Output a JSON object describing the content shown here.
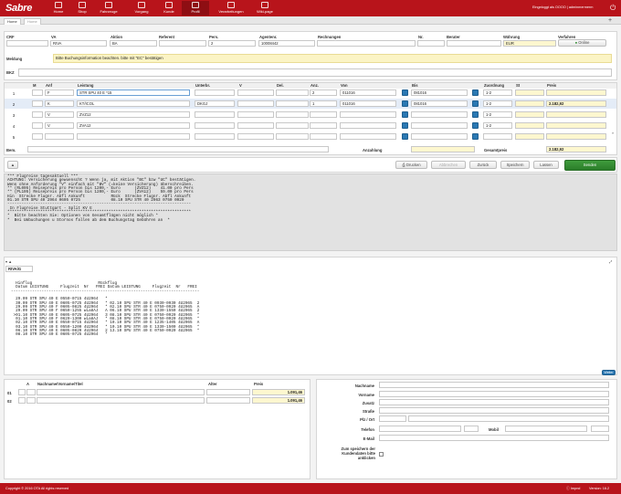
{
  "topbar": {
    "logo": "Sabre",
    "nav": [
      {
        "label": "Home"
      },
      {
        "label": "Shop"
      },
      {
        "label": "Fahrzeuge"
      },
      {
        "label": "Vorgang"
      },
      {
        "label": "Kunde"
      },
      {
        "label": "Profil"
      },
      {
        "label": "Verarbeitungen"
      },
      {
        "label": "Wiki-page"
      }
    ],
    "user": "Eingeloggt als OOOO | adminmermerm"
  },
  "tabs": [
    "Home",
    "Home"
  ],
  "booking_header": {
    "labels": [
      "CRF",
      "VA",
      "Aktion",
      "Referent",
      "Pers.",
      "Agentenr.",
      "Rechnungen",
      "Nr.",
      "Berater",
      "Währung",
      "Verfahren"
    ],
    "values": {
      "va": "RIVA",
      "aktion": "BA",
      "pers": "2",
      "agent": "10008442",
      "waehrung": "EUR",
      "verfahren": "Online"
    },
    "meldung_label": "Meldung",
    "meldung": "Bitte Buchungsinformation beachten. bitte mit \"EC\" bestätigen",
    "bkz_label": "BKZ"
  },
  "grid": {
    "headers": [
      "M",
      "Anf",
      "Leistung",
      "Unterbr.",
      "V",
      "Del.",
      "Anz.",
      "Von",
      "Bis",
      "Zuordnung",
      "St",
      "Preis"
    ],
    "rows": [
      {
        "n": "1",
        "anf": "F",
        "leistung": "STR SPU 40 E *15",
        "unterbr": "",
        "anz": "2",
        "von": "011016",
        "bis": "081016",
        "zuord": "1-2",
        "preis": ""
      },
      {
        "n": "2",
        "anf": "K",
        "leistung": "KT/ICOL",
        "unterbr": "DKGJ",
        "anz": "1",
        "von": "011016",
        "bis": "081016",
        "zuord": "1-2",
        "preis": "2.182,92"
      },
      {
        "n": "3",
        "anf": "V",
        "leistung": "ZVZ12",
        "unterbr": "",
        "anz": "",
        "von": "",
        "bis": "",
        "zuord": "1-2",
        "preis": ""
      },
      {
        "n": "4",
        "anf": "V",
        "leistung": "ZVA12",
        "unterbr": "",
        "anz": "",
        "von": "",
        "bis": "",
        "zuord": "1-2",
        "preis": ""
      },
      {
        "n": "5",
        "anf": "",
        "leistung": "",
        "unterbr": "",
        "anz": "",
        "von": "",
        "bis": "",
        "zuord": "",
        "preis": ""
      }
    ],
    "bem_label": "Bem.",
    "anzahlung_label": "Anzahlung",
    "gesamtpreis_label": "Gesamtpreis",
    "gesamtpreis": "2.182,92"
  },
  "actions": {
    "drucken": "Drucken",
    "abbrechen": "Abbrechen",
    "zurueck": "Zurück",
    "speichern": "Speichern",
    "loeschen": "Lassen",
    "senden": "Senden"
  },
  "terminal1": "*** Flugreise tagesaktuell ***\nACHTUNG: Versicherung gewuenscht ? Wenn ja, mit Aktion \"BC\" bzw \"UC\" bestätigen.\nWenn ohne Anforderung \"V\" einfach mit \"BV\" (=keine Versicherung) überschreiben.\n** (RL005) Reisepreis pro Person bis 1200,- Euro      (ZVZ12)    41.00 pro Pers\n** (PL105) Reisepreis pro Person bis 1200,- Euro      (ZVA12)    59.00 pro Pers\nHin  Strecke Flugnr. Abfl Ankunft           Rück  Strecke Flugnr. Abfl Ankunft\n01.10 STR SPU 40 2964 0605 0725             08.10 SPU STR 40 2963 0750 0920\n------------------------------------------------------------------------------\n In Flugreise Stuttgart - Split KV E\n******************************************************************************\n*  Bitte beachten Sie: Optionen von Gesamtflügen nicht möglich *\n*  Bei Umbuchungen u Stornos fallen ab dem Buchungstag Gebühren an  *",
  "subpanel": {
    "field": "RIVA/G"
  },
  "terminal2": "  Hinflug                            Rückflug\n  Datum LEISTUNG     Flugzeit  Nr   FREI Datum LEISTUNG     Flugzeit  Nr   FREI\n--------------------------------------------------------------------------------\n\n  29.09 STR SPU 40 E 0550-0715 4U2964   *\n  30.09 STR SPU 40 E 0605-0725 4U2964   * 02.10 SPU STR 40 E 0930-0930 4U2965  2\n  29.09 STR SPU 40 F 0605-0825 4U2964   * 02.10 SPU STR 40 E 0750-0920 4U2965  A\n  29.09 STR SPU 40 F 0650-1255 wia8AJ   A 06.10 SPU STR 40 E 1330-1550 4U2965  2\n >01.10 STR SPU 40 E 0605-0725 4U2964   3 08.10 SPU STR 40 E 0750-0920 4U2965  *\n  01.10 STR SPU 40 F 0620-1300 wia8AJ   * 08.10 SPU STR 40 E 0750-0920 4U2965  *\n  02.10 STR SPU 40 E 0550-0715 4U2964   * 10.10 SPU STR 40 E 1235-1405 4U2965  A\n  03.10 STR SPU 40 E 0550-1200 4U2964   * 10.10 SPU STR 40 E 1330-1500 4U2965  *\n  06.10 STR SPU 40 E 0605-0820 4U2964   2 13.10 SPU STR 40 E 0750-0920 4U2965  *\n  08.10 STR SPU 40 E 0605-0725 4U2964   *",
  "weiter": "Weiter",
  "passengers": {
    "headers": [
      "A",
      "Nachname/Vorname/Titel",
      "Alter",
      "Preis"
    ],
    "rows": [
      {
        "n": "01",
        "preis": "1.091,46"
      },
      {
        "n": "02",
        "preis": "1.091,46"
      }
    ]
  },
  "customer": {
    "labels": [
      "Nachname",
      "Vorname",
      "Zusatz",
      "Straße",
      "Plz / Ort",
      "Telefon",
      "Mobil",
      "E-Mail"
    ],
    "checkbox_label": "Zum speichern der Kundendaten bitte anklicken"
  },
  "footer": {
    "copyright": "Copyright © 2016 OTA All rights reserved",
    "right1": "Impnd",
    "version": "Version: 16.2"
  },
  "colors": {
    "brand": "#b8141b",
    "send": "#2f8a2e",
    "blue_btn": "#2a78b3"
  }
}
